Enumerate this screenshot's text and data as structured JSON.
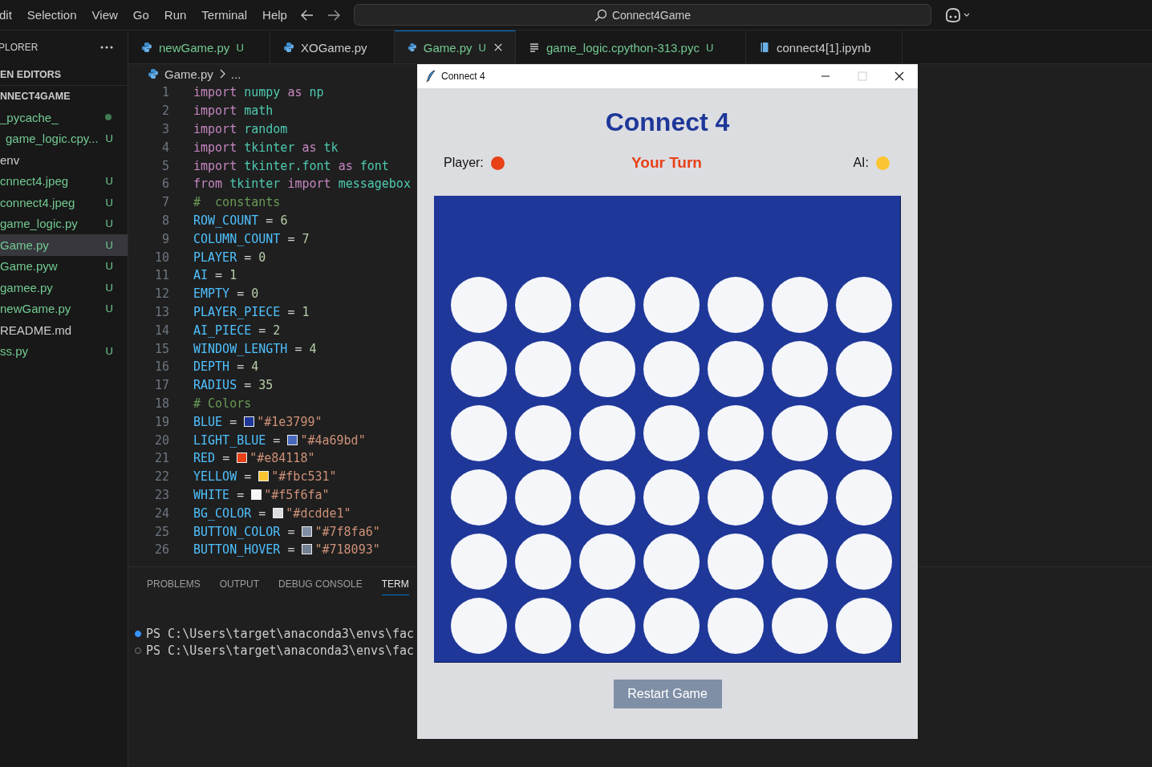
{
  "menu_bar": {
    "items": [
      "dit",
      "Selection",
      "View",
      "Go",
      "Run",
      "Terminal",
      "Help"
    ],
    "search": {
      "value": "Connect4Game"
    }
  },
  "explorer": {
    "title": "PLORER",
    "sections": [
      {
        "label": "EN EDITORS"
      },
      {
        "label": "NNECT4GAME"
      }
    ],
    "files": [
      {
        "label": "_pycache_",
        "untracked": true,
        "dot": true,
        "selected": false,
        "children": [
          {
            "label": "game_logic.cpy...",
            "untracked": true,
            "badge": "U",
            "selected": false
          }
        ]
      },
      {
        "label": "env",
        "untracked": false,
        "selected": false
      },
      {
        "label": "cnnect4.jpeg",
        "untracked": true,
        "badge": "U",
        "selected": false
      },
      {
        "label": "connect4.jpeg",
        "untracked": true,
        "badge": "U",
        "selected": false
      },
      {
        "label": "game_logic.py",
        "untracked": true,
        "badge": "U",
        "selected": false
      },
      {
        "label": "Game.py",
        "untracked": true,
        "badge": "U",
        "selected": true
      },
      {
        "label": "Game.pyw",
        "untracked": true,
        "badge": "U",
        "selected": false
      },
      {
        "label": "gamee.py",
        "untracked": true,
        "badge": "U",
        "selected": false
      },
      {
        "label": "newGame.py",
        "untracked": true,
        "badge": "U",
        "selected": false
      },
      {
        "label": "README.md",
        "untracked": false,
        "selected": false
      },
      {
        "label": "ss.py",
        "untracked": true,
        "badge": "U",
        "selected": false
      }
    ]
  },
  "tabs": [
    {
      "label": "newGame.py",
      "kind": "python",
      "untracked": true,
      "badge": "U",
      "selected": false
    },
    {
      "label": "XOGame.py",
      "kind": "python",
      "untracked": false,
      "selected": false
    },
    {
      "label": "Game.py",
      "kind": "python",
      "untracked": true,
      "badge": "U",
      "selected": true
    },
    {
      "label": "game_logic.cpython-313.pyc",
      "kind": "text",
      "untracked": true,
      "badge": "U",
      "selected": false
    },
    {
      "label": "connect4[1].ipynb",
      "kind": "notebook",
      "untracked": false,
      "selected": false
    }
  ],
  "breadcrumb": [
    "Game.py",
    "..."
  ],
  "code": [
    {
      "number": "1",
      "tokens": [
        {
          "kind": "keyword",
          "text": "import"
        },
        {
          "kind": "module",
          "text": "numpy"
        },
        {
          "kind": "keyword",
          "text": "as"
        },
        {
          "kind": "module",
          "text": "np"
        }
      ]
    },
    {
      "number": "2",
      "tokens": [
        {
          "kind": "keyword",
          "text": "import"
        },
        {
          "kind": "module",
          "text": "math"
        }
      ]
    },
    {
      "number": "3",
      "tokens": [
        {
          "kind": "keyword",
          "text": "import"
        },
        {
          "kind": "module",
          "text": "random"
        }
      ]
    },
    {
      "number": "4",
      "tokens": [
        {
          "kind": "keyword",
          "text": "import"
        },
        {
          "kind": "module",
          "text": "tkinter"
        },
        {
          "kind": "keyword",
          "text": "as"
        },
        {
          "kind": "module",
          "text": "tk"
        }
      ]
    },
    {
      "number": "5",
      "tokens": [
        {
          "kind": "keyword",
          "text": "import"
        },
        {
          "kind": "module",
          "text": "tkinter.font"
        },
        {
          "kind": "keyword",
          "text": "as"
        },
        {
          "kind": "module",
          "text": "font"
        }
      ]
    },
    {
      "number": "6",
      "tokens": [
        {
          "kind": "keyword",
          "text": "from"
        },
        {
          "kind": "module",
          "text": "tkinter"
        },
        {
          "kind": "keyword",
          "text": "import"
        },
        {
          "kind": "module",
          "text": "messagebox"
        }
      ]
    },
    {
      "number": "7",
      "tokens": [
        {
          "kind": "comment",
          "text": "#  constants"
        }
      ]
    },
    {
      "number": "8",
      "tokens": [
        {
          "kind": "variable",
          "text": "ROW_COUNT"
        },
        {
          "kind": "operator",
          "text": "="
        },
        {
          "kind": "number",
          "text": "6"
        }
      ]
    },
    {
      "number": "9",
      "tokens": [
        {
          "kind": "variable",
          "text": "COLUMN_COUNT"
        },
        {
          "kind": "operator",
          "text": "="
        },
        {
          "kind": "number",
          "text": "7"
        }
      ]
    },
    {
      "number": "10",
      "tokens": [
        {
          "kind": "variable",
          "text": "PLAYER"
        },
        {
          "kind": "operator",
          "text": "="
        },
        {
          "kind": "number",
          "text": "0"
        }
      ]
    },
    {
      "number": "11",
      "tokens": [
        {
          "kind": "variable",
          "text": "AI"
        },
        {
          "kind": "operator",
          "text": "="
        },
        {
          "kind": "number",
          "text": "1"
        }
      ]
    },
    {
      "number": "12",
      "tokens": [
        {
          "kind": "variable",
          "text": "EMPTY"
        },
        {
          "kind": "operator",
          "text": "="
        },
        {
          "kind": "number",
          "text": "0"
        }
      ]
    },
    {
      "number": "13",
      "tokens": [
        {
          "kind": "variable",
          "text": "PLAYER_PIECE"
        },
        {
          "kind": "operator",
          "text": "="
        },
        {
          "kind": "number",
          "text": "1"
        }
      ]
    },
    {
      "number": "14",
      "tokens": [
        {
          "kind": "variable",
          "text": "AI_PIECE"
        },
        {
          "kind": "operator",
          "text": "="
        },
        {
          "kind": "number",
          "text": "2"
        }
      ]
    },
    {
      "number": "15",
      "tokens": [
        {
          "kind": "variable",
          "text": "WINDOW_LENGTH"
        },
        {
          "kind": "operator",
          "text": "="
        },
        {
          "kind": "number",
          "text": "4"
        }
      ]
    },
    {
      "number": "16",
      "tokens": [
        {
          "kind": "variable",
          "text": "DEPTH"
        },
        {
          "kind": "operator",
          "text": "="
        },
        {
          "kind": "number",
          "text": "4"
        }
      ]
    },
    {
      "number": "17",
      "tokens": [
        {
          "kind": "variable",
          "text": "RADIUS"
        },
        {
          "kind": "operator",
          "text": "="
        },
        {
          "kind": "number",
          "text": "35"
        }
      ]
    },
    {
      "number": "18",
      "tokens": [
        {
          "kind": "comment",
          "text": "# Colors"
        }
      ]
    },
    {
      "number": "19",
      "tokens": [
        {
          "kind": "variable",
          "text": "BLUE"
        },
        {
          "kind": "operator",
          "text": "="
        },
        {
          "kind": "swatch",
          "color": "#1e3799"
        },
        {
          "kind": "string",
          "text": "\"#1e3799\""
        }
      ]
    },
    {
      "number": "20",
      "tokens": [
        {
          "kind": "variable",
          "text": "LIGHT_BLUE"
        },
        {
          "kind": "operator",
          "text": "="
        },
        {
          "kind": "swatch",
          "color": "#4a69bd"
        },
        {
          "kind": "string",
          "text": "\"#4a69bd\""
        }
      ]
    },
    {
      "number": "21",
      "tokens": [
        {
          "kind": "variable",
          "text": "RED"
        },
        {
          "kind": "operator",
          "text": "="
        },
        {
          "kind": "swatch",
          "color": "#e84118"
        },
        {
          "kind": "string",
          "text": "\"#e84118\""
        }
      ]
    },
    {
      "number": "22",
      "tokens": [
        {
          "kind": "variable",
          "text": "YELLOW"
        },
        {
          "kind": "operator",
          "text": "="
        },
        {
          "kind": "swatch",
          "color": "#fbc531"
        },
        {
          "kind": "string",
          "text": "\"#fbc531\""
        }
      ]
    },
    {
      "number": "23",
      "tokens": [
        {
          "kind": "variable",
          "text": "WHITE"
        },
        {
          "kind": "operator",
          "text": "="
        },
        {
          "kind": "swatch",
          "color": "#f5f6fa"
        },
        {
          "kind": "string",
          "text": "\"#f5f6fa\""
        }
      ]
    },
    {
      "number": "24",
      "tokens": [
        {
          "kind": "variable",
          "text": "BG_COLOR"
        },
        {
          "kind": "operator",
          "text": "="
        },
        {
          "kind": "swatch",
          "color": "#dcdde1"
        },
        {
          "kind": "string",
          "text": "\"#dcdde1\""
        }
      ]
    },
    {
      "number": "25",
      "tokens": [
        {
          "kind": "variable",
          "text": "BUTTON_COLOR"
        },
        {
          "kind": "operator",
          "text": "="
        },
        {
          "kind": "swatch",
          "color": "#7f8fa6"
        },
        {
          "kind": "string",
          "text": "\"#7f8fa6\""
        }
      ]
    },
    {
      "number": "26",
      "tokens": [
        {
          "kind": "variable",
          "text": "BUTTON_HOVER"
        },
        {
          "kind": "operator",
          "text": "="
        },
        {
          "kind": "swatch",
          "color": "#718093"
        },
        {
          "kind": "string",
          "text": "\"#718093\""
        }
      ]
    }
  ],
  "panel": {
    "tabs": [
      {
        "label": "PROBLEMS",
        "selected": false
      },
      {
        "label": "OUTPUT",
        "selected": false
      },
      {
        "label": "DEBUG CONSOLE",
        "selected": false
      },
      {
        "label": "TERM",
        "selected": true
      }
    ],
    "terminal_lines": [
      {
        "text": "PS C:\\Users\\target\\anaconda3\\envs\\fac",
        "highlighted": true
      },
      {
        "text": "PS C:\\Users\\target\\anaconda3\\envs\\fac",
        "highlighted": false
      }
    ]
  },
  "game_window": {
    "title": "Connect 4",
    "heading": "Connect 4",
    "player": {
      "label": "Player:",
      "color": "#e84118"
    },
    "status": "Your Turn",
    "ai": {
      "label": "AI:",
      "color": "#fbc531"
    },
    "board": {
      "cells": [
        [
          {
            "kind": "empty"
          },
          {
            "kind": "empty"
          },
          {
            "kind": "empty"
          },
          {
            "kind": "empty"
          },
          {
            "kind": "empty"
          },
          {
            "kind": "empty"
          },
          {
            "kind": "empty"
          }
        ],
        [
          {
            "kind": "empty"
          },
          {
            "kind": "empty"
          },
          {
            "kind": "empty"
          },
          {
            "kind": "empty"
          },
          {
            "kind": "empty"
          },
          {
            "kind": "empty"
          },
          {
            "kind": "empty"
          }
        ],
        [
          {
            "kind": "empty"
          },
          {
            "kind": "empty"
          },
          {
            "kind": "empty"
          },
          {
            "kind": "empty"
          },
          {
            "kind": "empty"
          },
          {
            "kind": "empty"
          },
          {
            "kind": "empty"
          }
        ],
        [
          {
            "kind": "empty"
          },
          {
            "kind": "empty"
          },
          {
            "kind": "empty"
          },
          {
            "kind": "empty"
          },
          {
            "kind": "empty"
          },
          {
            "kind": "empty"
          },
          {
            "kind": "empty"
          }
        ],
        [
          {
            "kind": "empty"
          },
          {
            "kind": "empty"
          },
          {
            "kind": "empty"
          },
          {
            "kind": "empty"
          },
          {
            "kind": "empty"
          },
          {
            "kind": "empty"
          },
          {
            "kind": "empty"
          }
        ],
        [
          {
            "kind": "empty"
          },
          {
            "kind": "empty"
          },
          {
            "kind": "empty"
          },
          {
            "kind": "empty"
          },
          {
            "kind": "empty"
          },
          {
            "kind": "empty"
          },
          {
            "kind": "empty"
          }
        ]
      ]
    },
    "button": "Restart Game"
  }
}
